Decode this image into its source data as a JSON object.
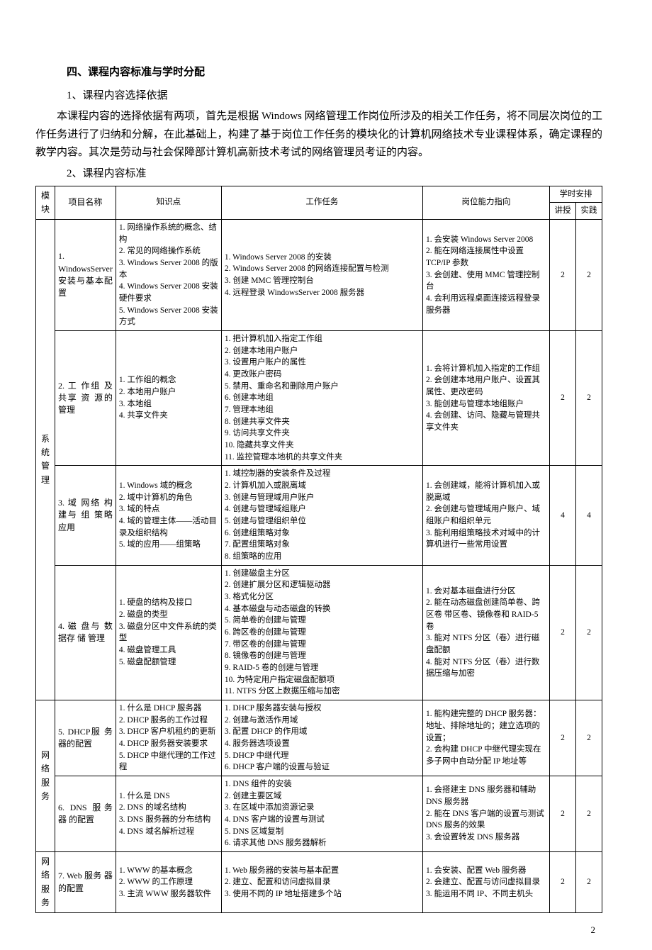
{
  "heading": "四、课程内容标准与学时分配",
  "sub1": "1、课程内容选择依据",
  "para1": "本课程内容的选择依据有两项，首先是根据 Windows 网络管理工作岗位所涉及的相关工作任务，将不同层次岗位的工作任务进行了归纳和分解，在此基础上，构建了基于岗位工作任务的模块化的计算机网络技术专业课程体系，确定课程的教学内容。其次是劳动与社会保障部计算机高新技术考试的网络管理员考证的内容。",
  "sub2": "2、课程内容标准",
  "headers": {
    "module": "模块",
    "project": "项目名称",
    "knowledge": "知识点",
    "task": "工作任务",
    "ability": "岗位能力指向",
    "hours_group": "学时安排",
    "lecture": "讲授",
    "practice": "实践"
  },
  "modules": [
    {
      "label": "系统管理",
      "rows": [
        {
          "project": "1. WindowsServer 安装与基本配置",
          "knowledge": "1. 网络操作系统的概念、结构\n2. 常见的网络操作系统\n3. Windows Server 2008 的版本\n4. Windows Server 2008 安装硬件要求\n5. Windows Server 2008 安装方式",
          "task": "1. Windows Server 2008 的安装\n2. Windows Server 2008 的网络连接配置与检测\n3. 创建 MMC 管理控制台\n4. 远程登录 WindowsServer 2008 服务器",
          "ability": "1. 会安装 Windows Server 2008\n2. 能在网络连接属性中设置TCP/IP 参数\n3. 会创建、使用 MMC 管理控制台\n4. 会利用远程桌面连接远程登录服务器",
          "lecture": "2",
          "practice": "2"
        },
        {
          "project": "2. 工 作组 及 共享 资 源的管理",
          "knowledge": "1. 工作组的概念\n2. 本地用户账户\n3. 本地组\n4. 共享文件夹",
          "task": "1. 把计算机加入指定工作组\n2. 创建本地用户账户\n3. 设置用户账户的属性\n4. 更改账户密码\n5. 禁用、重命名和删除用户账户\n6. 创建本地组\n7. 管理本地组\n8. 创建共享文件夹\n9. 访问共享文件夹\n10. 隐藏共享文件夹\n11. 监控管理本地机的共享文件夹",
          "ability": "1. 会将计算机加入指定的工作组\n2. 会创建本地用户账户、设置其属性、更改密码\n3. 能创建与管理本地组账户\n4. 会创建、访问、隐藏与管理共享文件夹",
          "lecture": "2",
          "practice": "2"
        },
        {
          "project": "3. 域 网络 构 建与 组 策略应用",
          "knowledge": "1. Windows 域的概念\n2. 域中计算机的角色\n3. 域的特点\n4. 域的管理主体——活动目录及组织结构\n5. 域的应用——组策略",
          "task": "1. 域控制器的安装条件及过程\n2. 计算机加入或脱离域\n3. 创建与管理域用户账户\n4. 创建与管理域组账户\n5. 创建与管理组织单位\n6. 创建组策略对象\n7. 配置组策略对象\n8. 组策略的应用",
          "ability": "1. 会创建域，能将计算机加入或脱离域\n2. 会创建与管理域用户账户、域组账户和组织单元\n3. 能利用组策略技术对域中的计算机进行一些常用设置",
          "lecture": "4",
          "practice": "4"
        },
        {
          "project": "4. 磁 盘与 数 据存 储 管理",
          "knowledge": "1. 硬盘的结构及接口\n2. 磁盘的类型\n3. 磁盘分区中文件系统的类型\n4. 磁盘管理工具\n5. 磁盘配额管理",
          "task": "1. 创建磁盘主分区\n2. 创建扩展分区和逻辑驱动器\n3. 格式化分区\n4. 基本磁盘与动态磁盘的转换\n5. 简单卷的创建与管理\n6. 跨区卷的创建与管理\n7. 带区卷的创建与管理\n8. 镜像卷的创建与管理\n9. RAID-5 卷的创建与管理\n10. 为特定用户指定磁盘配额项\n11. NTFS 分区上数据压缩与加密",
          "ability": "1. 会对基本磁盘进行分区\n2. 能在动态磁盘创建简单卷、跨区卷 带区卷、镜像卷和 RAID-5 卷\n3. 能对 NTFS 分区（卷）进行磁盘配额\n4. 能对 NTFS 分区（卷）进行数据压缩与加密",
          "lecture": "2",
          "practice": "2"
        }
      ]
    },
    {
      "label": "网络服务",
      "rows": [
        {
          "project": "5. DHCP服 务 器的配置",
          "knowledge": "1. 什么是 DHCP 服务器\n2. DHCP 服务的工作过程\n3. DHCP 客户机租约的更新\n4. DHCP 服务器安装要求\n5. DHCP 中继代理的工作过程",
          "task": "1. DHCP 服务器安装与授权\n2. 创建与激活作用域\n3. 配置 DHCP 的作用域\n4. 服务器选项设置\n5. DHCP 中继代理\n6. DHCP 客户端的设置与验证",
          "ability": "1. 能构建完整的 DHCP 服务器：地址、排除地址的；建立选项的设置；\n2. 会构建 DHCP 中继代理实现在多子网中自动分配 IP 地址等",
          "lecture": "2",
          "practice": "2"
        },
        {
          "project": "6. DNS 服务 器 的配置",
          "knowledge": "1. 什么是 DNS\n2. DNS 的域名结构\n3. DNS 服务器的分布结构\n4. DNS 域名解析过程",
          "task": "1. DNS 组件的安装\n2. 创建主要区域\n3. 在区域中添加资源记录\n4. DNS 客户端的设置与测试\n5. DNS 区域复制\n6. 请求其他 DNS 服务器解析",
          "ability": "1. 会搭建主 DNS 服务器和辅助DNS 服务器\n2. 能在 DNS 客户端的设置与测试DNS 服务的效果\n3. 会设置转发 DNS 服务器",
          "lecture": "2",
          "practice": "2"
        }
      ]
    },
    {
      "label": "网络服务",
      "rows": [
        {
          "project": "7. Web 服务 器 的配置",
          "knowledge": "1. WWW 的基本概念\n2. WWW 的工作原理\n3. 主流 WWW 服务器软件",
          "task": "1. Web 服务器的安装与基本配置\n2. 建立、配置和访问虚拟目录\n3. 使用不同的 IP 地址搭建多个站",
          "ability": "1. 会安装、配置 Web 服务器\n2. 会建立、配置与访问虚拟目录\n3. 能运用不同 IP、不同主机头",
          "lecture": "2",
          "practice": "2"
        }
      ]
    }
  ],
  "page_number": "2"
}
